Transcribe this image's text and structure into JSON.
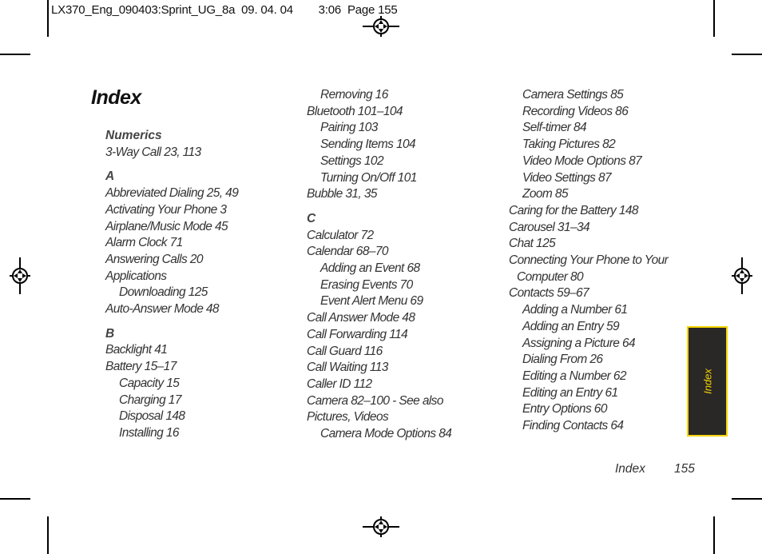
{
  "slug_line": "LX370_Eng_090403:Sprint_UG_8a  09. 04. 04        3:06  Page 155",
  "title": "Index",
  "columns": [
    {
      "entries": [
        {
          "type": "header",
          "text": "Numerics"
        },
        {
          "type": "main",
          "text": "3-Way Call  23, 113"
        },
        {
          "type": "header",
          "text": "A"
        },
        {
          "type": "main",
          "text": "Abbreviated Dialing  25, 49"
        },
        {
          "type": "main",
          "text": "Activating Your Phone  3"
        },
        {
          "type": "main",
          "text": "Airplane/Music Mode  45"
        },
        {
          "type": "main",
          "text": "Alarm Clock  71"
        },
        {
          "type": "main",
          "text": "Answering Calls  20"
        },
        {
          "type": "main",
          "text": "Applications"
        },
        {
          "type": "sub",
          "text": "Downloading  125"
        },
        {
          "type": "main",
          "text": "Auto-Answer Mode  48"
        },
        {
          "type": "header",
          "text": "B"
        },
        {
          "type": "main",
          "text": "Backlight  41"
        },
        {
          "type": "main",
          "text": "Battery  15–17"
        },
        {
          "type": "sub",
          "text": "Capacity  15"
        },
        {
          "type": "sub",
          "text": "Charging  17"
        },
        {
          "type": "sub",
          "text": "Disposal  148"
        },
        {
          "type": "sub",
          "text": "Installing  16"
        }
      ]
    },
    {
      "entries": [
        {
          "type": "sub",
          "text": "Removing  16"
        },
        {
          "type": "main",
          "text": "Bluetooth  101–104"
        },
        {
          "type": "sub",
          "text": "Pairing  103"
        },
        {
          "type": "sub",
          "text": "Sending Items  104"
        },
        {
          "type": "sub",
          "text": "Settings  102"
        },
        {
          "type": "sub",
          "text": "Turning On/Off  101"
        },
        {
          "type": "main",
          "text": "Bubble  31, 35"
        },
        {
          "type": "header",
          "text": "C"
        },
        {
          "type": "main",
          "text": "Calculator  72"
        },
        {
          "type": "main",
          "text": "Calendar  68–70"
        },
        {
          "type": "sub",
          "text": "Adding an Event  68"
        },
        {
          "type": "sub",
          "text": "Erasing Events  70"
        },
        {
          "type": "sub",
          "text": "Event Alert Menu  69"
        },
        {
          "type": "main",
          "text": "Call Answer Mode  48"
        },
        {
          "type": "main",
          "text": "Call Forwarding  114"
        },
        {
          "type": "main",
          "text": "Call Guard  116"
        },
        {
          "type": "main",
          "text": "Call Waiting  113"
        },
        {
          "type": "main",
          "text": "Caller ID  112"
        },
        {
          "type": "main",
          "text": "Camera  82–100 - See also"
        },
        {
          "type": "main",
          "text": "Pictures, Videos"
        },
        {
          "type": "sub",
          "text": "Camera Mode Options  84"
        }
      ]
    },
    {
      "entries": [
        {
          "type": "sub",
          "text": "Camera Settings  85"
        },
        {
          "type": "sub",
          "text": "Recording Videos  86"
        },
        {
          "type": "sub",
          "text": "Self-timer  84"
        },
        {
          "type": "sub",
          "text": "Taking Pictures  82"
        },
        {
          "type": "sub",
          "text": "Video Mode Options  87"
        },
        {
          "type": "sub",
          "text": "Video Settings  87"
        },
        {
          "type": "sub",
          "text": "Zoom  85"
        },
        {
          "type": "main",
          "text": "Caring for the Battery  148"
        },
        {
          "type": "main",
          "text": "Carousel  31–34"
        },
        {
          "type": "main",
          "text": "Chat  125"
        },
        {
          "type": "main",
          "text": "Connecting Your Phone to Your"
        },
        {
          "type": "cont",
          "text": "Computer  80"
        },
        {
          "type": "main",
          "text": "Contacts  59–67"
        },
        {
          "type": "sub",
          "text": "Adding a Number  61"
        },
        {
          "type": "sub",
          "text": "Adding an Entry 59"
        },
        {
          "type": "sub",
          "text": "Assigning a Picture  64"
        },
        {
          "type": "sub",
          "text": "Dialing From  26"
        },
        {
          "type": "sub",
          "text": "Editing a Number  62"
        },
        {
          "type": "sub",
          "text": "Editing an Entry  61"
        },
        {
          "type": "sub",
          "text": "Entry Options  60"
        },
        {
          "type": "sub",
          "text": "Finding Contacts  64"
        }
      ]
    }
  ],
  "side_tab": {
    "label": "Index",
    "bg_color": "#2a2727",
    "accent_color": "#f5d400"
  },
  "footer": {
    "section": "Index",
    "page": "155"
  }
}
